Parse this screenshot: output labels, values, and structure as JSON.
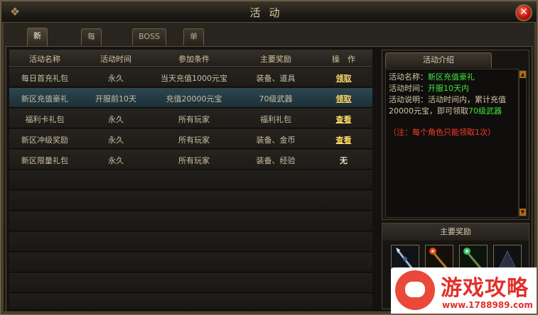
{
  "window": {
    "title": "活动"
  },
  "tabs": [
    {
      "label": "新区活动",
      "active": true
    },
    {
      "label": "每日活动",
      "active": false
    },
    {
      "label": "BOSS信息",
      "active": false
    },
    {
      "label": "单人副本",
      "active": false
    }
  ],
  "table": {
    "headers": [
      "活动名称",
      "活动时间",
      "参加条件",
      "主要奖励",
      "操　作"
    ],
    "rows": [
      {
        "name": "每日首充礼包",
        "time": "永久",
        "condition": "当天充值1000元宝",
        "reward": "装备、道具",
        "action": "领取",
        "action_type": "link"
      },
      {
        "name": "新区充值豪礼",
        "time": "开服前10天",
        "condition": "充值20000元宝",
        "reward": "70级武器",
        "action": "领取",
        "action_type": "link"
      },
      {
        "name": "福利卡礼包",
        "time": "永久",
        "condition": "所有玩家",
        "reward": "福利礼包",
        "action": "查看",
        "action_type": "link"
      },
      {
        "name": "新区冲级奖励",
        "time": "永久",
        "condition": "所有玩家",
        "reward": "装备、金币",
        "action": "查看",
        "action_type": "link"
      },
      {
        "name": "新区限量礼包",
        "time": "永久",
        "condition": "所有玩家",
        "reward": "装备、经验",
        "action": "无",
        "action_type": "plain"
      }
    ],
    "selected_row": 1
  },
  "info": {
    "header": "活动介绍",
    "name_label": "活动名称：",
    "name_value": "新区充值豪礼",
    "time_label": "活动时间：",
    "time_value": "开服10天内",
    "desc_line1": "活动说明：活动时间内，累计充值",
    "desc_line2_prefix": "20000元宝，即可领取",
    "desc_line2_value": "70级武器",
    "note": "（注：每个角色只能领取1次）"
  },
  "rewards": {
    "header": "主要奖励",
    "items": [
      {
        "icon": "spear-weapon-icon"
      },
      {
        "icon": "fire-staff-icon"
      },
      {
        "icon": "jade-staff-icon"
      },
      {
        "icon": "dark-weapon-icon"
      }
    ]
  },
  "watermark": {
    "title": "游戏攻略",
    "url": "www.1788989.com"
  },
  "colors": {
    "highlight_green": "#3ee63e",
    "note_red": "#ff3a2a",
    "link_gold": "#ffd96a",
    "selected_row": "#2d4750"
  }
}
